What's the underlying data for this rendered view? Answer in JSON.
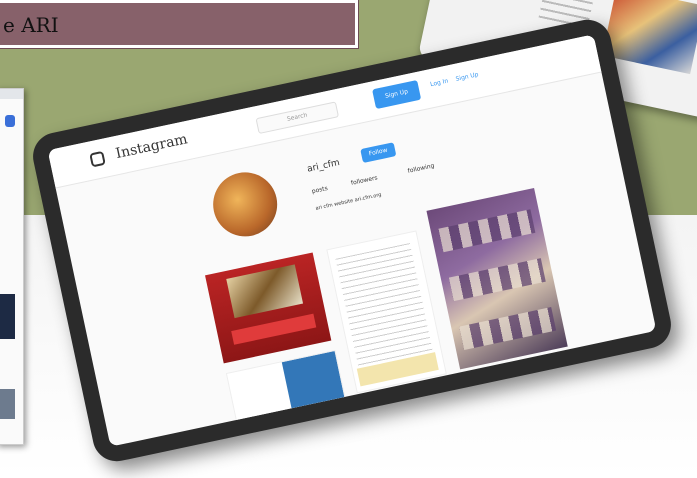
{
  "banner": {
    "text": "e ARI"
  },
  "instagram": {
    "logo_text": "Instagram",
    "search_placeholder": "Search",
    "signup_label": "Sign Up",
    "login_label": "Log In",
    "signup_link": "Sign Up",
    "username": "ari_cfm",
    "follow_label": "Follow",
    "stats": [
      "posts",
      "followers",
      "following"
    ],
    "bio": "ari cfm website ari.cfm.org"
  },
  "colors": {
    "olive": "#9aa771",
    "banner": "#87616a",
    "instagram_blue": "#3897f0",
    "tablet_bezel": "#2b2b2b"
  }
}
